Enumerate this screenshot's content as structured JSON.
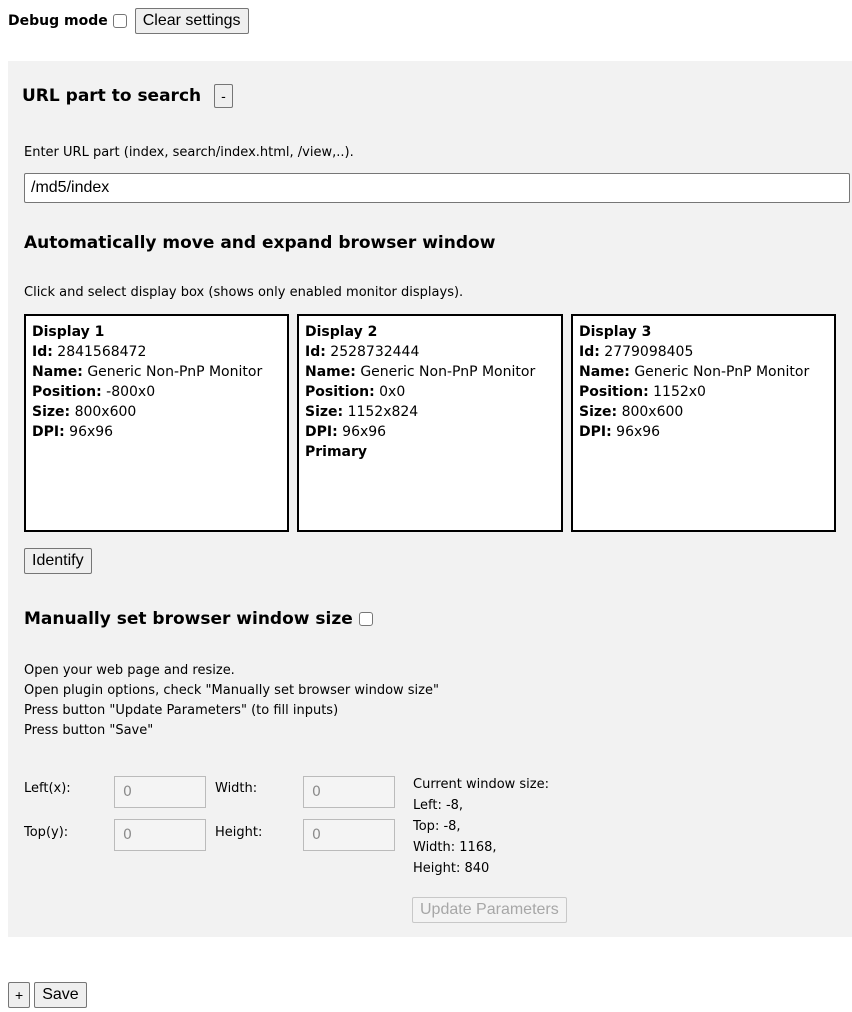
{
  "top": {
    "debug_label": "Debug mode",
    "clear_button": "Clear settings"
  },
  "url_section": {
    "title": "URL part to search",
    "collapse_button": "-",
    "hint": "Enter URL part (index, search/index.html, /view,..).",
    "value": "/md5/index"
  },
  "auto_section": {
    "title": "Automatically move and expand browser window",
    "hint": "Click and select display box (shows only enabled monitor displays).",
    "id_label": "Id:",
    "name_label": "Name:",
    "position_label": "Position:",
    "size_label": "Size:",
    "dpi_label": "DPI:",
    "displays": [
      {
        "title": "Display 1",
        "id": "2841568472",
        "name": "Generic Non-PnP Monitor",
        "position": "-800x0",
        "size": "800x600",
        "dpi": "96x96",
        "primary": ""
      },
      {
        "title": "Display 2",
        "id": "2528732444",
        "name": "Generic Non-PnP Monitor",
        "position": "0x0",
        "size": "1152x824",
        "dpi": "96x96",
        "primary": "Primary"
      },
      {
        "title": "Display 3",
        "id": "2779098405",
        "name": "Generic Non-PnP Monitor",
        "position": "1152x0",
        "size": "800x600",
        "dpi": "96x96",
        "primary": ""
      }
    ],
    "identify_button": "Identify"
  },
  "manual_section": {
    "title": "Manually set browser window size",
    "steps": [
      "Open your web page and resize.",
      "Open plugin options, check \"Manually set browser window size\"",
      "Press button \"Update Parameters\" (to fill inputs)",
      "Press button \"Save\""
    ],
    "left_label": "Left(x):",
    "top_label": "Top(y):",
    "width_label": "Width:",
    "height_label": "Height:",
    "left_value": "0",
    "top_value": "0",
    "width_value": "0",
    "height_value": "0",
    "current_title": "Current window size:",
    "current_left": "Left: -8,",
    "current_top": "Top: -8,",
    "current_width": "Width: 1168,",
    "current_height": "Height: 840",
    "update_button": "Update Parameters"
  },
  "bottom": {
    "add_button": "+",
    "save_button": "Save"
  }
}
